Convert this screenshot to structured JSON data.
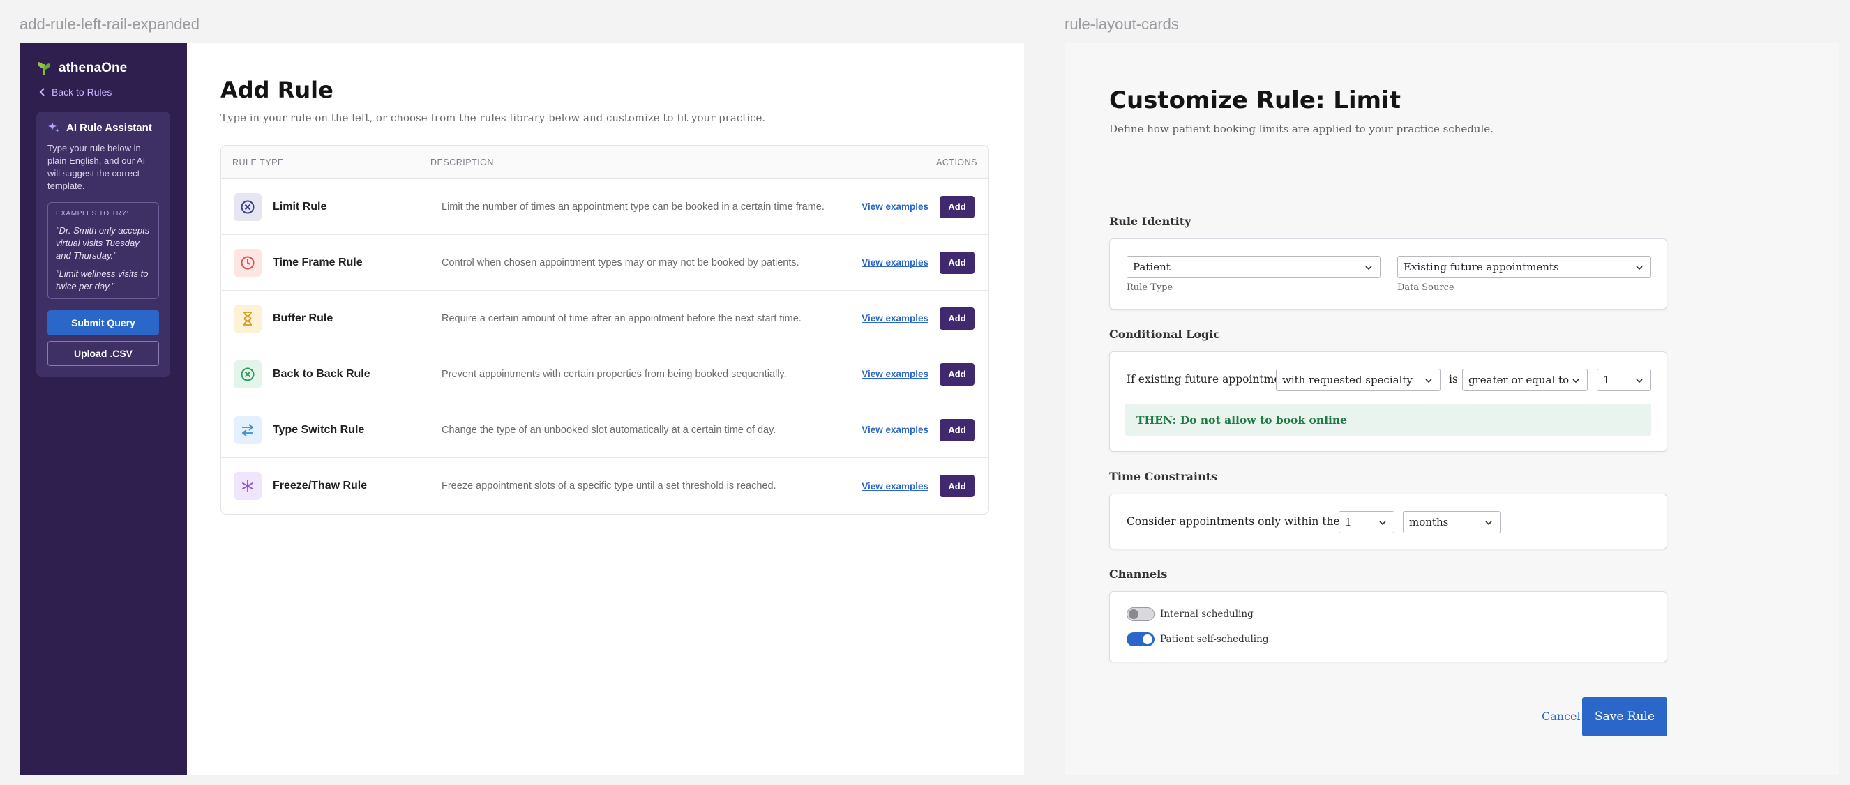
{
  "frames": {
    "left_label": "add-rule-left-rail-expanded",
    "right_label": "rule-layout-cards"
  },
  "rail": {
    "brand": "athenaOne",
    "back_link": "Back to Rules",
    "assistant": {
      "title": "AI Rule Assistant",
      "description": "Type your rule below in plain English, and our AI will suggest the correct template.",
      "examples_label": "EXAMPLES TO TRY:",
      "examples": [
        "\"Dr. Smith only accepts virtual visits Tuesday and Thursday.\"",
        "\"Limit wellness visits to twice per day.\""
      ],
      "submit_label": "Submit Query",
      "upload_label": "Upload .CSV"
    }
  },
  "add_rule": {
    "title": "Add Rule",
    "subtitle": "Type in your rule on the left, or choose from the rules library below and customize to fit your practice.",
    "columns": [
      "RULE TYPE",
      "DESCRIPTION",
      "ACTIONS"
    ],
    "view_label": "View examples",
    "add_label": "Add",
    "rules": [
      {
        "name": "Limit Rule",
        "icon": "limit-icon",
        "description": "Limit the number of times an appointment type can be booked in a certain time frame.",
        "color": "#3d3d8a",
        "bg": "#e6e6f2"
      },
      {
        "name": "Time Frame Rule",
        "icon": "clock-icon",
        "description": "Control when chosen appointment types may or may not be booked by patients.",
        "color": "#d9534f",
        "bg": "#fbe6e5"
      },
      {
        "name": "Buffer Rule",
        "icon": "hourglass-icon",
        "description": "Require a certain amount of time after an appointment before the next start time.",
        "color": "#d99a1e",
        "bg": "#fdf1d6"
      },
      {
        "name": "Back to Back Rule",
        "icon": "no-back-to-back-icon",
        "description": "Prevent appointments with certain properties from being booked sequentially.",
        "color": "#2f9d5c",
        "bg": "#e3f4ea"
      },
      {
        "name": "Type Switch Rule",
        "icon": "switch-arrows-icon",
        "description": "Change the type of an unbooked slot automatically at a certain time of day.",
        "color": "#3b8fd6",
        "bg": "#e4f0fb"
      },
      {
        "name": "Freeze/Thaw Rule",
        "icon": "snowflake-icon",
        "description": "Freeze appointment slots of a specific type until a set threshold is reached.",
        "color": "#8d4fd8",
        "bg": "#f0e6fb"
      }
    ]
  },
  "customize": {
    "title": "Customize Rule: Limit",
    "subtitle": "Define how patient booking limits are applied to your practice schedule.",
    "identity": {
      "label": "Rule Identity",
      "rule_type_value": "Patient",
      "rule_type_caption": "Rule Type",
      "data_source_value": "Existing future appointments",
      "data_source_caption": "Data Source"
    },
    "logic": {
      "label": "Conditional Logic",
      "if_text": "If existing future appointments",
      "filter_value": "with requested specialty",
      "is_text": "is",
      "operator_value": "greater or equal to",
      "count_value": "1",
      "then_text": "THEN: Do not allow to book online"
    },
    "time": {
      "label": "Time Constraints",
      "text": "Consider appointments only within the next",
      "amount_value": "1",
      "unit_value": "months"
    },
    "channels": {
      "label": "Channels",
      "internal_label": "Internal scheduling",
      "internal_on": false,
      "patient_label": "Patient self-scheduling",
      "patient_on": true
    },
    "cancel_label": "Cancel",
    "save_label": "Save Rule"
  },
  "colors": {
    "rail_bg": "#2e1f4f",
    "brand_purple": "#40296e",
    "primary_blue": "#2b67c8",
    "success_green": "#1f7a45"
  }
}
